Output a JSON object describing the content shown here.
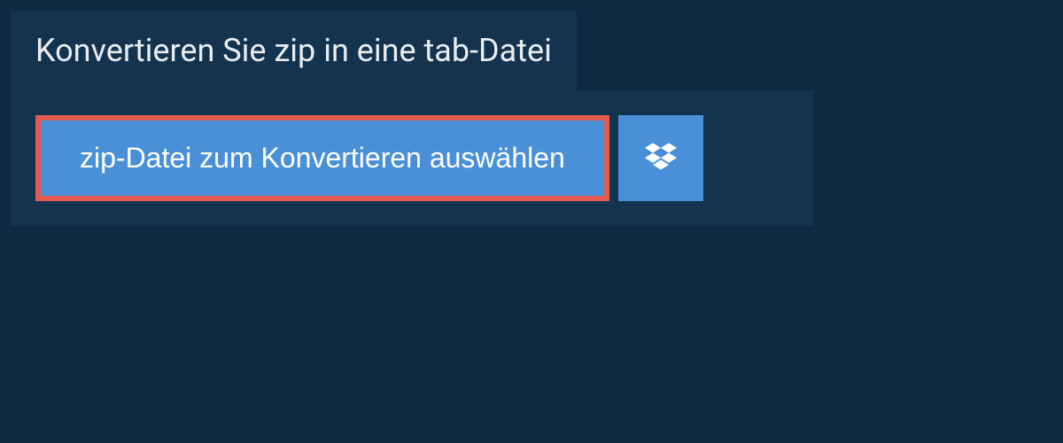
{
  "header": {
    "title": "Konvertieren Sie zip in eine tab-Datei"
  },
  "actions": {
    "select_file_label": "zip-Datei zum Konvertieren auswählen",
    "dropbox_icon": "dropbox-icon"
  },
  "colors": {
    "background": "#0e2a42",
    "panel": "#13334f",
    "accent": "#4a90d9",
    "highlight_border": "#e55a4f",
    "text": "#e8edf2"
  }
}
